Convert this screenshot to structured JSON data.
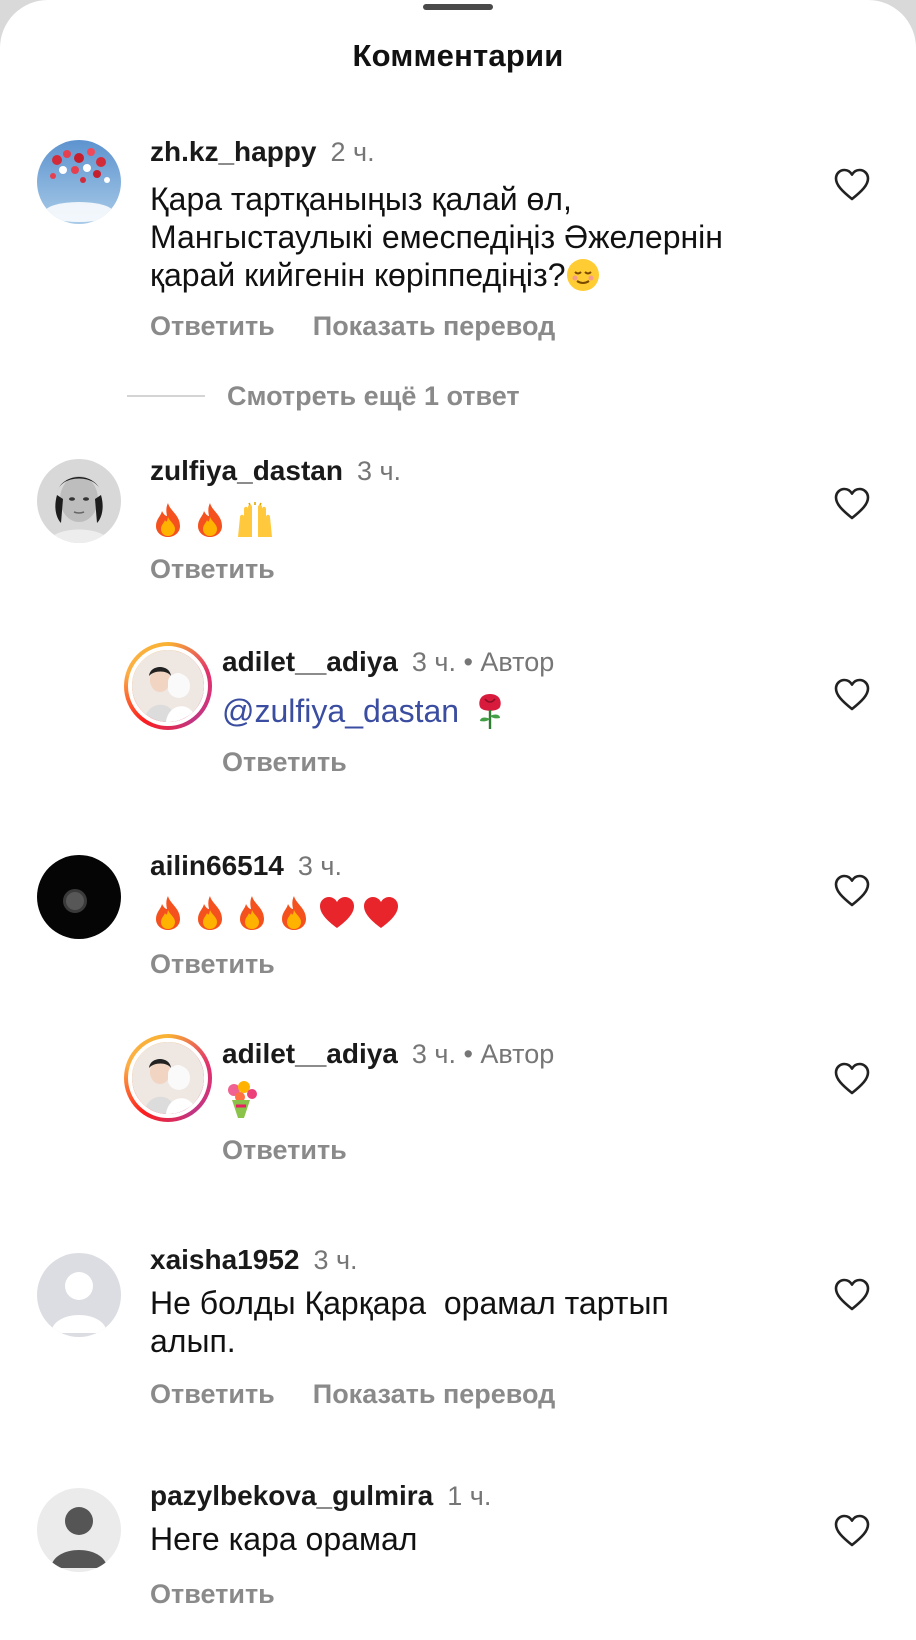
{
  "sheet": {
    "title": "Комментарии"
  },
  "comments": [
    {
      "username": "zh.kz_happy",
      "time": "2 ч.",
      "text_line1": "Қара тартқаныңыз қалай өл,",
      "text_line2": "Мангыстаулыкі емеспедіңіз Әжелернін",
      "text_line3": "қарай кийгенін көріппедіңіз?",
      "reply_label": "Ответить",
      "translate_label": "Показать перевод",
      "view_replies_label": "Смотреть ещё 1 ответ"
    },
    {
      "username": "zulfiya_dastan",
      "time": "3 ч.",
      "emojis": [
        "fire",
        "fire",
        "raised-hands"
      ],
      "reply_label": "Ответить"
    },
    {
      "username": "adilet__adiya",
      "time": "3 ч. • Автор",
      "mention": "@zulfiya_dastan",
      "emojis": [
        "rose"
      ],
      "reply_label": "Ответить"
    },
    {
      "username": "ailin66514",
      "time": "3 ч.",
      "emojis": [
        "fire",
        "fire",
        "fire",
        "fire",
        "red-heart",
        "red-heart"
      ],
      "reply_label": "Ответить"
    },
    {
      "username": "adilet__adiya",
      "time": "3 ч. • Автор",
      "emojis": [
        "bouquet"
      ],
      "reply_label": "Ответить"
    },
    {
      "username": "xaisha1952",
      "time": "3 ч.",
      "text_line1": "Не болды Қарқара  орамал тартып",
      "text_line2": "алып.",
      "reply_label": "Ответить",
      "translate_label": "Показать перевод"
    },
    {
      "username": "pazylbekova_gulmira",
      "time": "1 ч.",
      "text_line1": "Неге кара орамал",
      "reply_label": "Ответить"
    }
  ],
  "colors": {
    "username": "#1a1a1a",
    "meta": "#767676",
    "action": "#8a8a8a",
    "mention": "#3a4da0",
    "story_ring": "#e1306c"
  },
  "icons": {
    "like": "heart-outline-icon",
    "default_avatar": "person-silhouette-icon"
  }
}
